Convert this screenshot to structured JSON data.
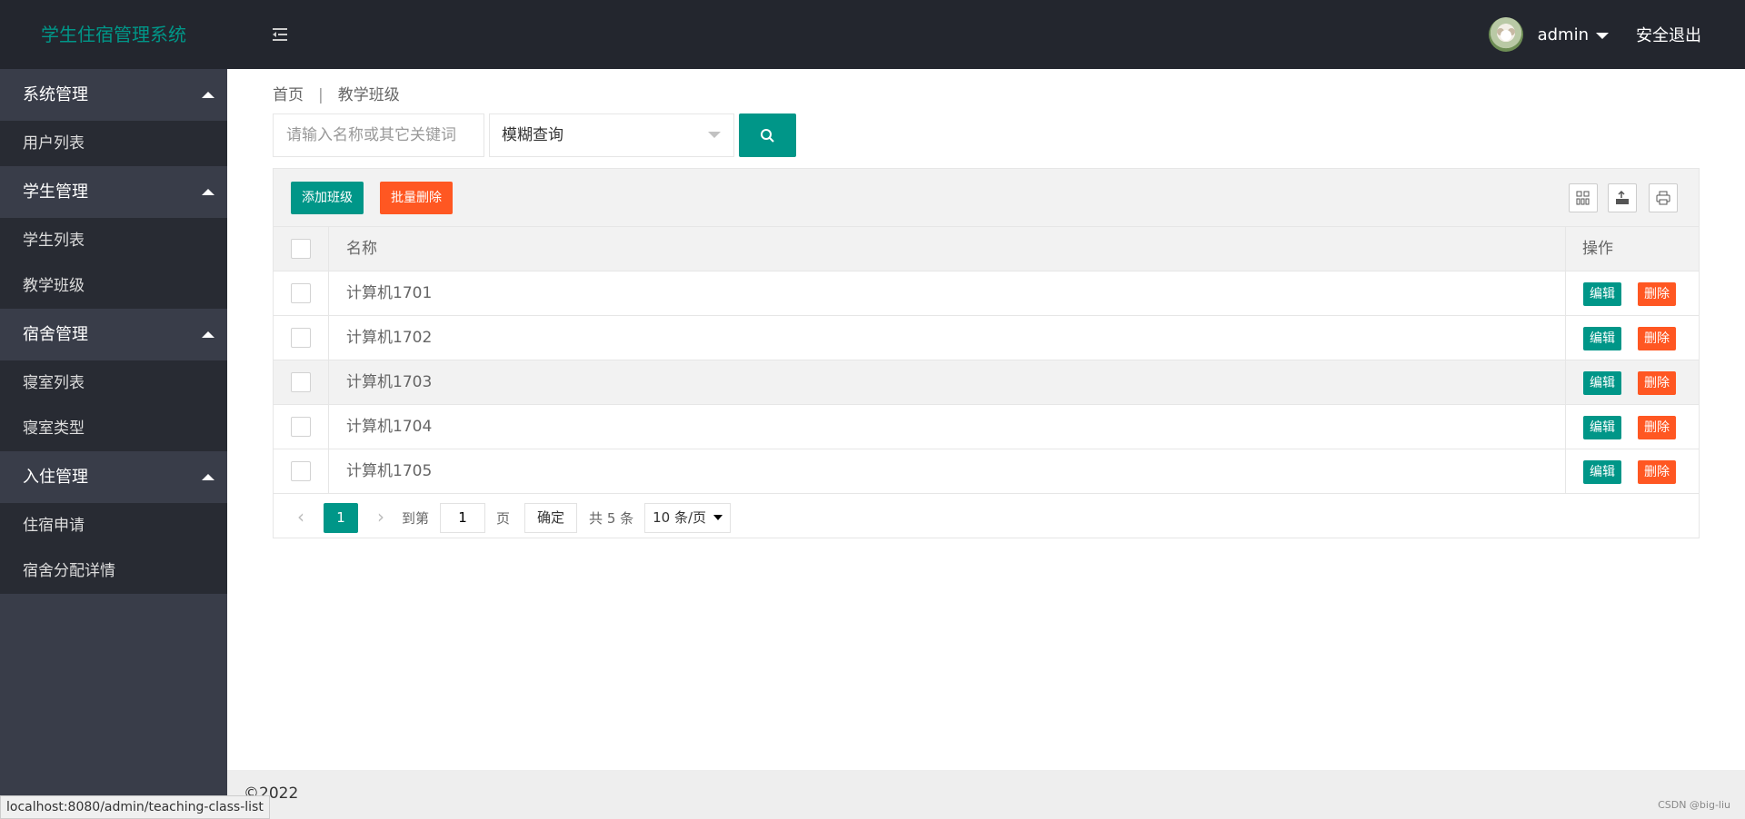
{
  "header": {
    "logo": "学生住宿管理系统",
    "username": "admin",
    "logout": "安全退出"
  },
  "sidebar": {
    "groups": [
      {
        "title": "系统管理",
        "items": [
          "用户列表"
        ]
      },
      {
        "title": "学生管理",
        "items": [
          "学生列表",
          "教学班级"
        ]
      },
      {
        "title": "宿舍管理",
        "items": [
          "寝室列表",
          "寝室类型"
        ]
      },
      {
        "title": "入住管理",
        "items": [
          "住宿申请",
          "宿舍分配详情"
        ]
      }
    ]
  },
  "breadcrumb": {
    "home": "首页",
    "sep": "|",
    "current": "教学班级"
  },
  "search": {
    "placeholder": "请输入名称或其它关键词",
    "mode": "模糊查询"
  },
  "toolbar": {
    "add": "添加班级",
    "batch_delete": "批量删除"
  },
  "table": {
    "columns": {
      "name": "名称",
      "ops": "操作"
    },
    "rows": [
      "计算机1701",
      "计算机1702",
      "计算机1703",
      "计算机1704",
      "计算机1705"
    ],
    "edit": "编辑",
    "delete": "删除"
  },
  "pager": {
    "current": "1",
    "goto_label": "到第",
    "goto_value": "1",
    "page_unit": "页",
    "confirm": "确定",
    "total": "共 5 条",
    "page_size": "10 条/页"
  },
  "footer": {
    "copyright": "©2022",
    "status_url": "localhost:8080/admin/teaching-class-list",
    "watermark": "CSDN @big-liu"
  },
  "colors": {
    "header_bg": "#23262e",
    "sidebar_bg": "#393d49",
    "primary": "#009688",
    "danger": "#ff5722"
  }
}
